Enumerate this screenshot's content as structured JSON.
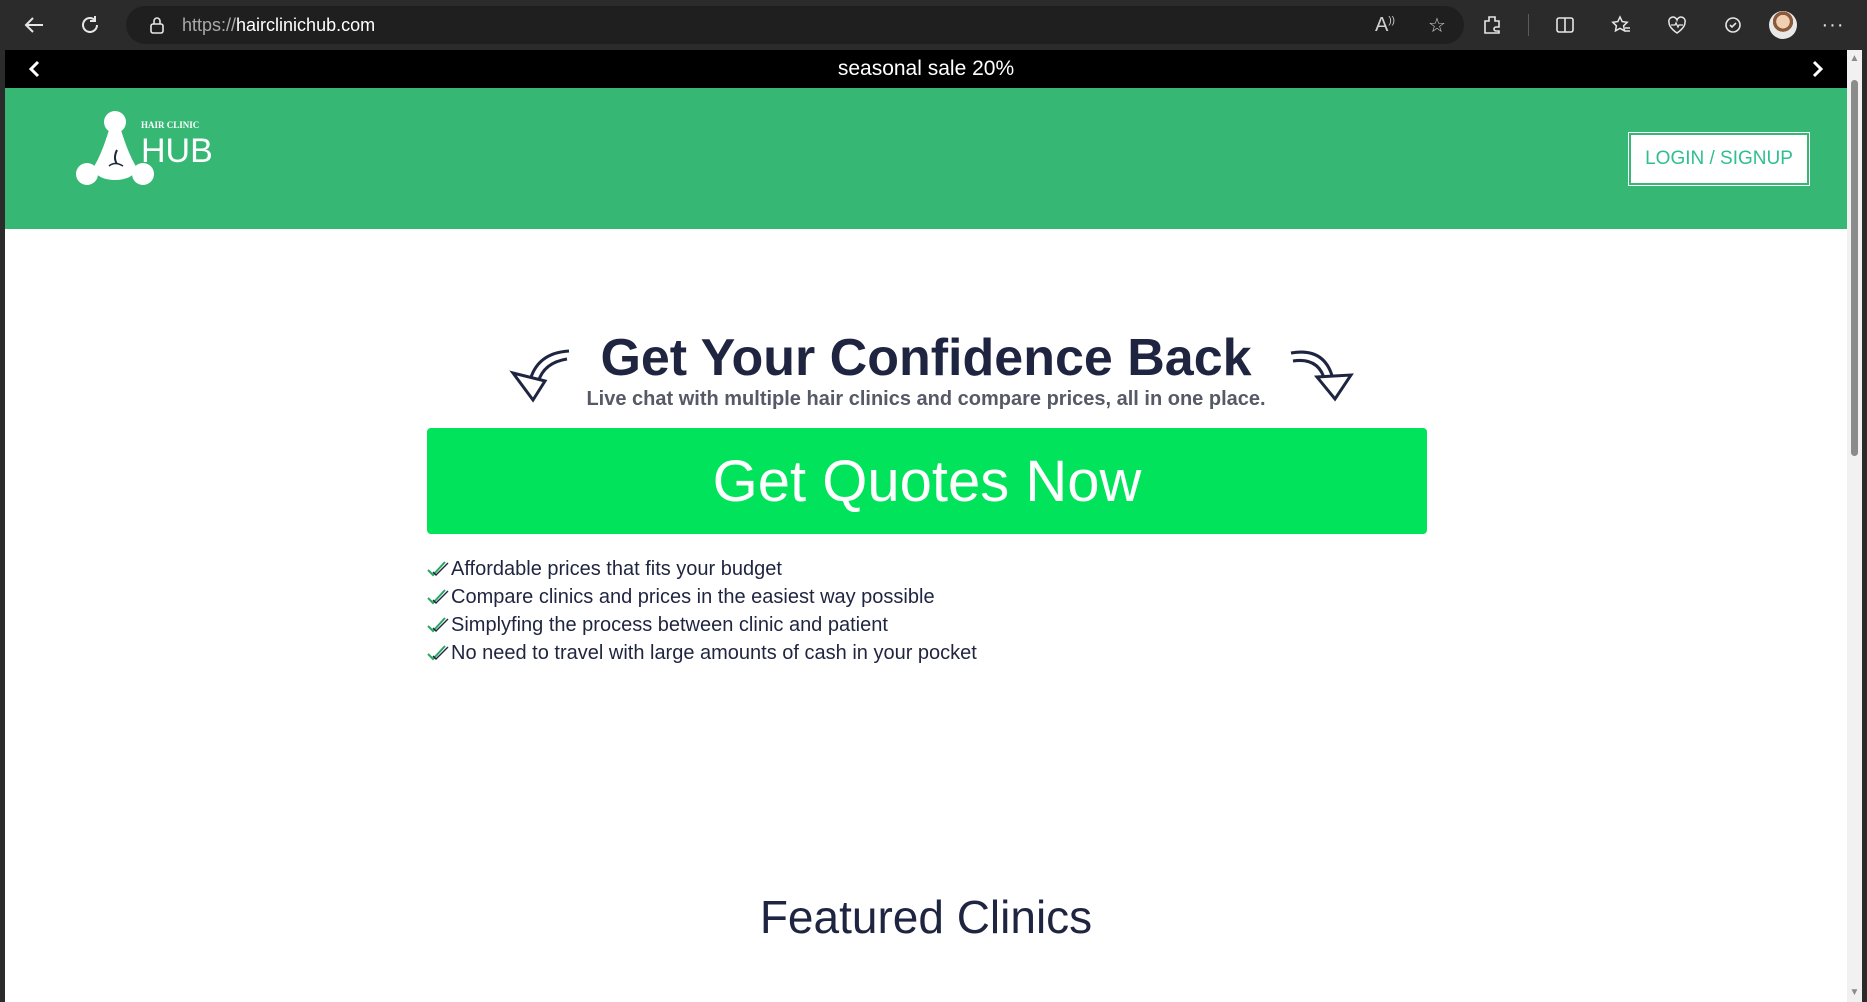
{
  "browser": {
    "url_protocol": "https://",
    "url_host": "hairclinichub.com"
  },
  "announcement": {
    "text": "seasonal sale 20%"
  },
  "header": {
    "logo_small": "HAIR CLINIC",
    "logo_big": "HUB",
    "login_label": "LOGIN / SIGNUP"
  },
  "hero": {
    "title": "Get Your Confidence Back",
    "subtitle": "Live chat with multiple hair clinics and compare prices, all in one place.",
    "cta_label": "Get Quotes Now"
  },
  "features": [
    "Affordable prices that fits your budget",
    "Compare clinics and prices in the easiest way possible",
    "Simplyfing the process between clinic and patient",
    "No need to travel with large amounts of cash in your pocket"
  ],
  "featured": {
    "title": "Featured Clinics"
  },
  "colors": {
    "header_bg": "#36b874",
    "cta_bg": "#00e35b",
    "heading": "#1f2540",
    "login_text": "#2fbf8f"
  }
}
